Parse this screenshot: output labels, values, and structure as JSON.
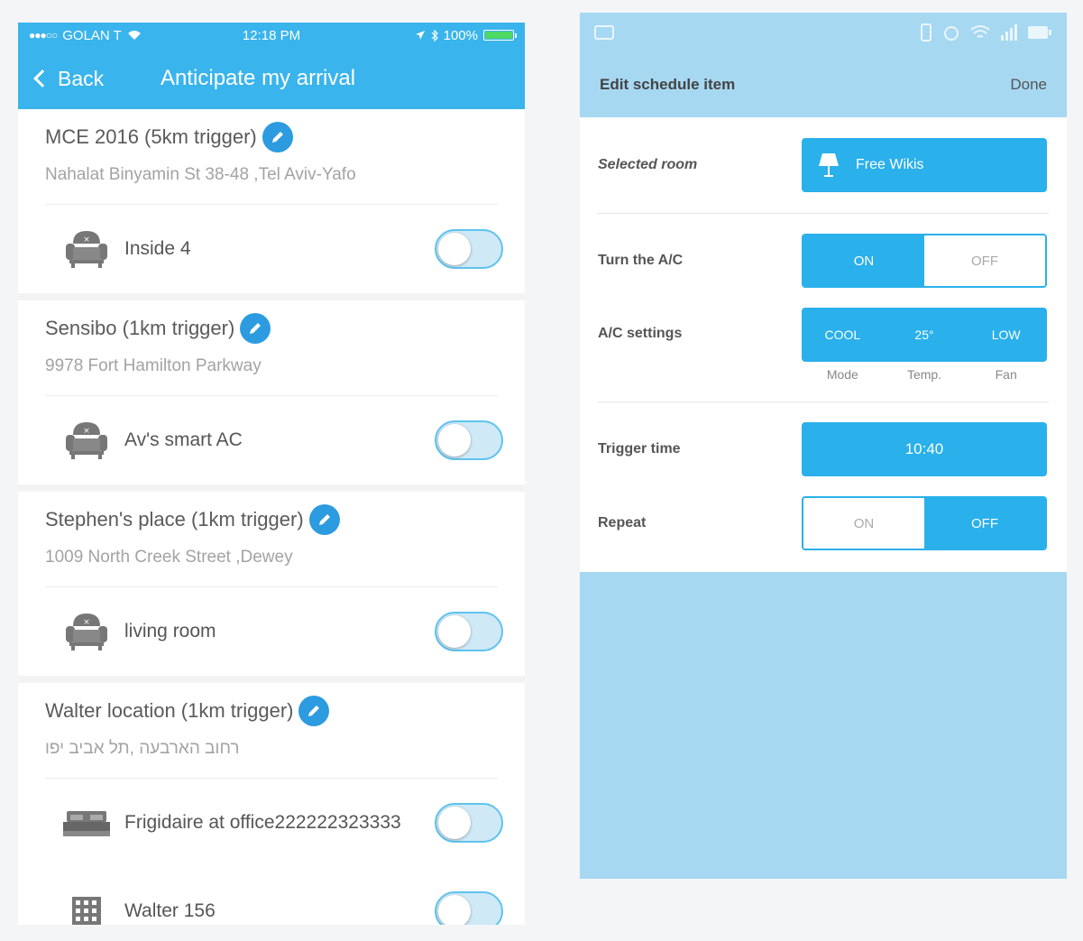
{
  "left": {
    "status": {
      "carrier": "GOLAN T",
      "time": "12:18 PM",
      "battery": "100%"
    },
    "nav": {
      "back_label": "Back",
      "title": "Anticipate my arrival"
    },
    "locations": [
      {
        "title": "MCE 2016  (5km trigger)",
        "address": "Nahalat Binyamin St 38-48 ,Tel Aviv-Yafo",
        "devices": [
          {
            "label": "Inside 4",
            "icon": "armchair-icon",
            "on": false
          }
        ]
      },
      {
        "title": "Sensibo  (1km trigger)",
        "address": "9978 Fort Hamilton Parkway",
        "devices": [
          {
            "label": "Av's smart AC",
            "icon": "armchair-icon",
            "on": false
          }
        ]
      },
      {
        "title": "Stephen's place  (1km trigger)",
        "address": "1009 North Creek Street ,Dewey",
        "devices": [
          {
            "label": "living room",
            "icon": "armchair-icon",
            "on": false
          }
        ]
      },
      {
        "title": "Walter location  (1km trigger)",
        "address": "רחוב הארבעה ,תל אביב יפו",
        "devices": [
          {
            "label": "Frigidaire at office222222323333",
            "icon": "bed-icon",
            "on": false
          },
          {
            "label": "Walter 156",
            "icon": "building-icon",
            "on": false
          }
        ]
      }
    ]
  },
  "right": {
    "toolbar": {
      "title": "Edit schedule item",
      "done_label": "Done"
    },
    "selected_room": {
      "label": "Selected room",
      "value": "Free Wikis"
    },
    "turn_ac": {
      "label": "Turn the A/C",
      "on_label": "ON",
      "off_label": "OFF",
      "selected": "ON"
    },
    "ac_settings": {
      "label": "A/C settings",
      "mode": "COOL",
      "temp": "25°",
      "fan": "LOW",
      "mode_caption": "Mode",
      "temp_caption": "Temp.",
      "fan_caption": "Fan"
    },
    "trigger_time": {
      "label": "Trigger time",
      "value": "10:40"
    },
    "repeat": {
      "label": "Repeat",
      "on_label": "ON",
      "off_label": "OFF",
      "selected": "OFF"
    }
  },
  "colors": {
    "ios_blue": "#3ab4ec",
    "accent": "#2ab0ea",
    "android_bg": "#a6d8f2"
  }
}
